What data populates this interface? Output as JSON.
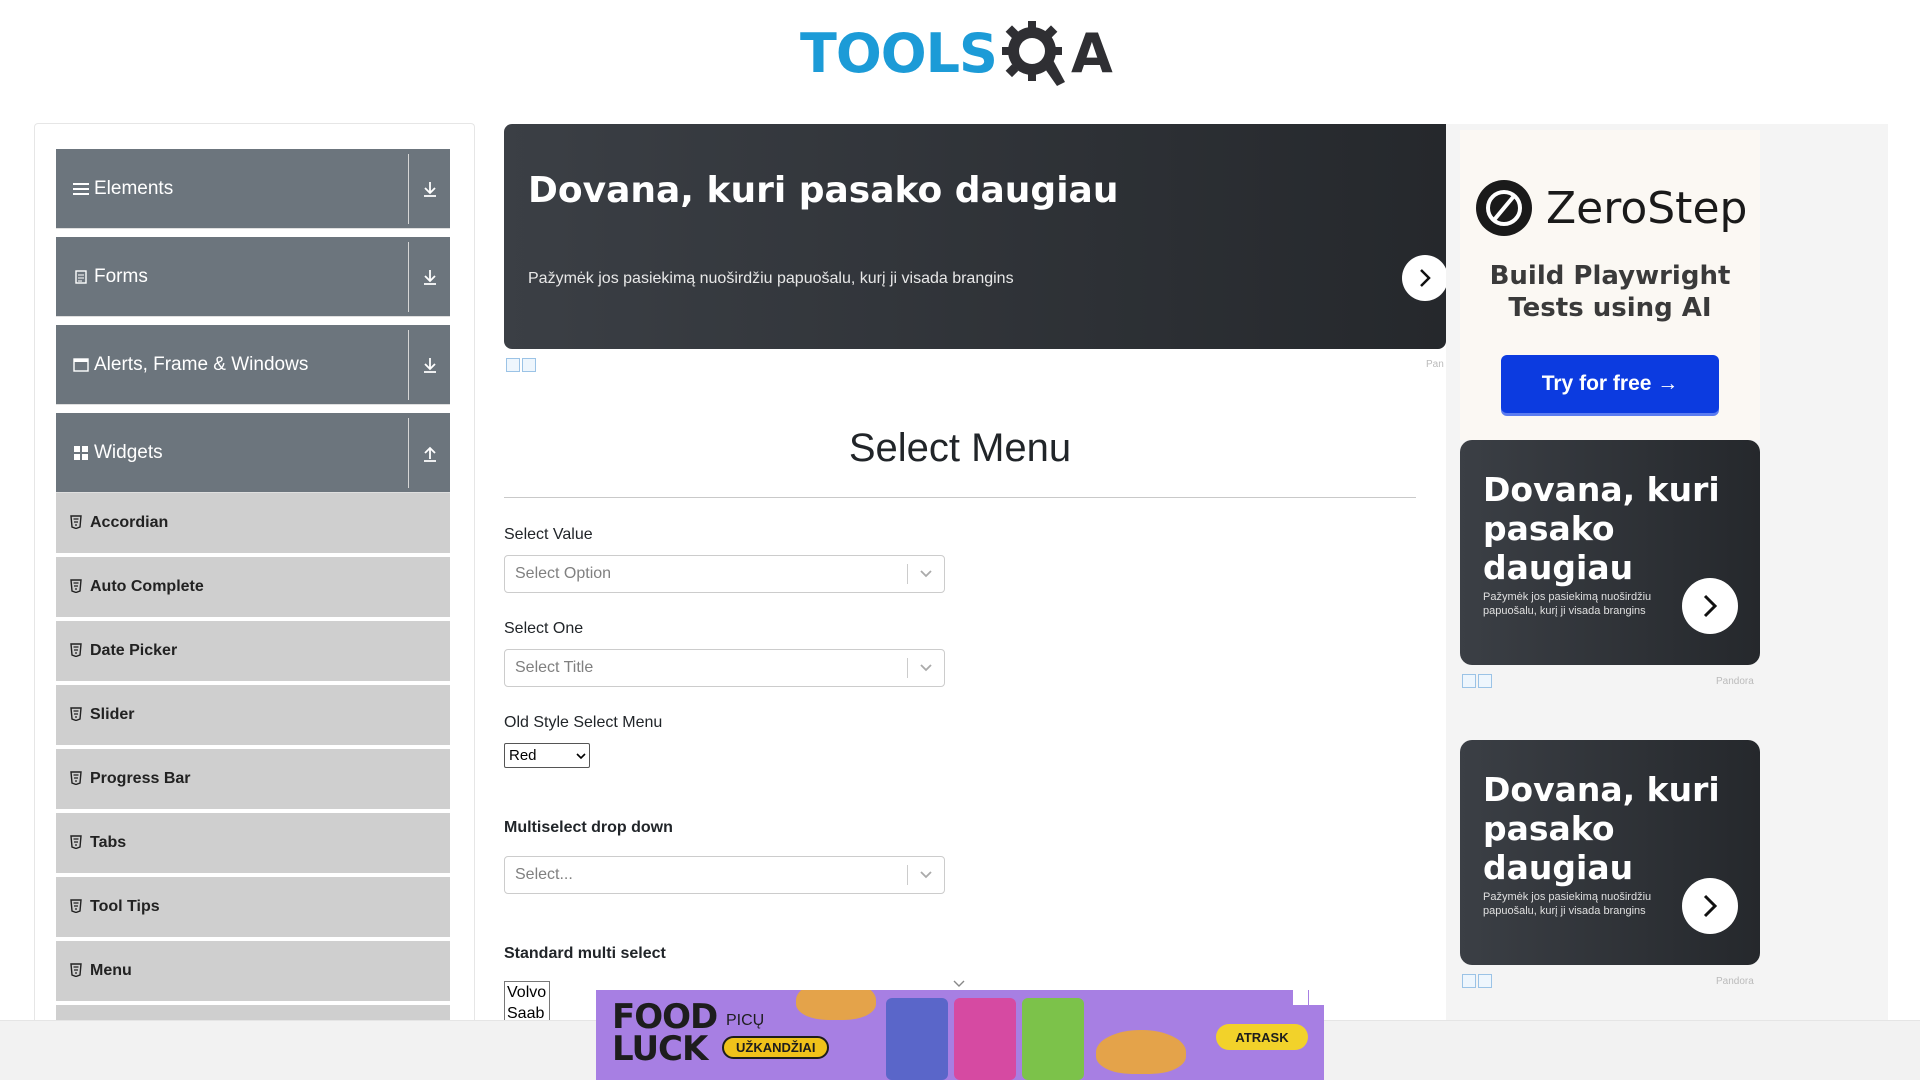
{
  "header": {
    "logo_text_1": "TOOLS",
    "logo_text_2": "A"
  },
  "sidebar": {
    "groups": [
      {
        "label": "Elements",
        "icon": "hamburger-icon",
        "state": "collapsed"
      },
      {
        "label": "Forms",
        "icon": "document-icon",
        "state": "collapsed"
      },
      {
        "label": "Alerts, Frame & Windows",
        "icon": "window-icon",
        "state": "collapsed"
      },
      {
        "label": "Widgets",
        "icon": "grid-icon",
        "state": "expanded"
      }
    ],
    "widget_items": [
      {
        "label": "Accordian"
      },
      {
        "label": "Auto Complete"
      },
      {
        "label": "Date Picker"
      },
      {
        "label": "Slider"
      },
      {
        "label": "Progress Bar"
      },
      {
        "label": "Tabs"
      },
      {
        "label": "Tool Tips"
      },
      {
        "label": "Menu"
      }
    ]
  },
  "top_ad": {
    "title": "Dovana, kuri pasako daugiau",
    "subtitle": "Pažymėk jos pasiekimą nuoširdžiu papuošalu, kurį ji visada brangins",
    "source": "Pan"
  },
  "main": {
    "page_title": "Select Menu",
    "select_value": {
      "label": "Select Value",
      "placeholder": "Select Option"
    },
    "select_one": {
      "label": "Select One",
      "placeholder": "Select Title"
    },
    "old_style": {
      "label": "Old Style Select Menu",
      "value": "Red"
    },
    "multiselect": {
      "label": "Multiselect drop down",
      "placeholder": "Select..."
    },
    "standard_multi": {
      "label": "Standard multi select",
      "options": [
        "Volvo",
        "Saab"
      ]
    }
  },
  "right_ads": {
    "zerostep": {
      "brand": "ZeroStep",
      "tagline_1": "Build Playwright",
      "tagline_2": "Tests using AI",
      "cta": "Try for free →"
    },
    "side_ad_1": {
      "title_1": "Dovana, kuri",
      "title_2": "pasako daugiau",
      "subtitle": "Pažymėk jos pasiekimą nuoširdžiu papuošalu, kurį ji visada brangins",
      "source": "Pandora"
    },
    "side_ad_2": {
      "title_1": "Dovana, kuri",
      "title_2": "pasako daugiau",
      "subtitle": "Pažymėk jos pasiekimą nuoširdžiu papuošalu, kurį ji visada brangins",
      "source": "Pandora"
    }
  },
  "bottom_ad": {
    "brand_1": "FOOD",
    "brand_2": "LUCK",
    "line_1": "PICŲ",
    "line_2": "UŽKANDŽIAI",
    "cta": "ATRASK"
  },
  "colors": {
    "logo_blue": "#1c9bd7",
    "nav_group": "#6c757d",
    "nav_item": "#cfcfcf",
    "ad_dark": "#2f3338",
    "zerostep_button": "#0c3be0",
    "bottom_ad_purple": "#a77fe3"
  }
}
